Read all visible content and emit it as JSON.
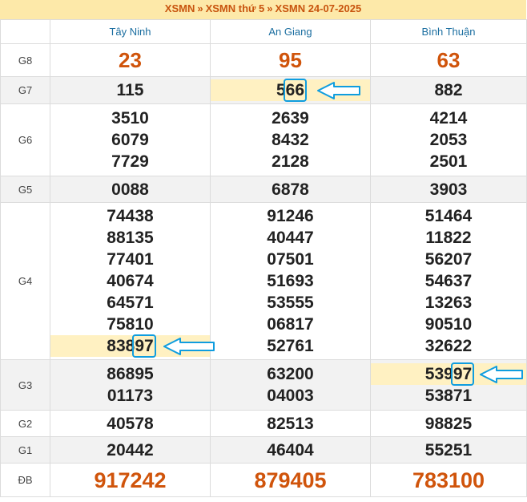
{
  "breadcrumb": {
    "items": [
      "XSMN",
      "XSMN thứ 5",
      "XSMN 24-07-2025"
    ],
    "separator": "»"
  },
  "provinces": [
    "Tây Ninh",
    "An Giang",
    "Bình Thuận"
  ],
  "prizes": [
    {
      "label": "G8",
      "values": [
        [
          "23"
        ],
        [
          "95"
        ],
        [
          "63"
        ]
      ]
    },
    {
      "label": "G7",
      "values": [
        [
          "115"
        ],
        [
          "566"
        ],
        [
          "882"
        ]
      ]
    },
    {
      "label": "G6",
      "values": [
        [
          "3510",
          "6079",
          "7729"
        ],
        [
          "2639",
          "8432",
          "2128"
        ],
        [
          "4214",
          "2053",
          "2501"
        ]
      ]
    },
    {
      "label": "G5",
      "values": [
        [
          "0088"
        ],
        [
          "6878"
        ],
        [
          "3903"
        ]
      ]
    },
    {
      "label": "G4",
      "values": [
        [
          "74438",
          "88135",
          "77401",
          "40674",
          "64571",
          "75810",
          "83897"
        ],
        [
          "91246",
          "40447",
          "07501",
          "51693",
          "53555",
          "06817",
          "52761"
        ],
        [
          "51464",
          "11822",
          "56207",
          "54637",
          "13263",
          "90510",
          "32622"
        ]
      ]
    },
    {
      "label": "G3",
      "values": [
        [
          "86895",
          "01173"
        ],
        [
          "63200",
          "04003"
        ],
        [
          "53997",
          "53871"
        ]
      ]
    },
    {
      "label": "G2",
      "values": [
        [
          "40578"
        ],
        [
          "82513"
        ],
        [
          "98825"
        ]
      ]
    },
    {
      "label": "G1",
      "values": [
        [
          "20442"
        ],
        [
          "46404"
        ],
        [
          "55251"
        ]
      ]
    },
    {
      "label": "ĐB",
      "values": [
        [
          "917242"
        ],
        [
          "879405"
        ],
        [
          "783100"
        ]
      ]
    }
  ],
  "highlights": [
    {
      "prize": "G7",
      "province": 1,
      "index": 0
    },
    {
      "prize": "G4",
      "province": 0,
      "index": 6
    },
    {
      "prize": "G3",
      "province": 2,
      "index": 0
    }
  ],
  "colors": {
    "header_bg": "#fde9a9",
    "breadcrumb_text": "#c8540e",
    "province_text": "#1b6ea0",
    "special_number": "#d0540b",
    "highlight_bg": "#fff1c2",
    "marker": "#0f9ddf"
  },
  "icons": {
    "annotation": "arrow-left-icon"
  }
}
